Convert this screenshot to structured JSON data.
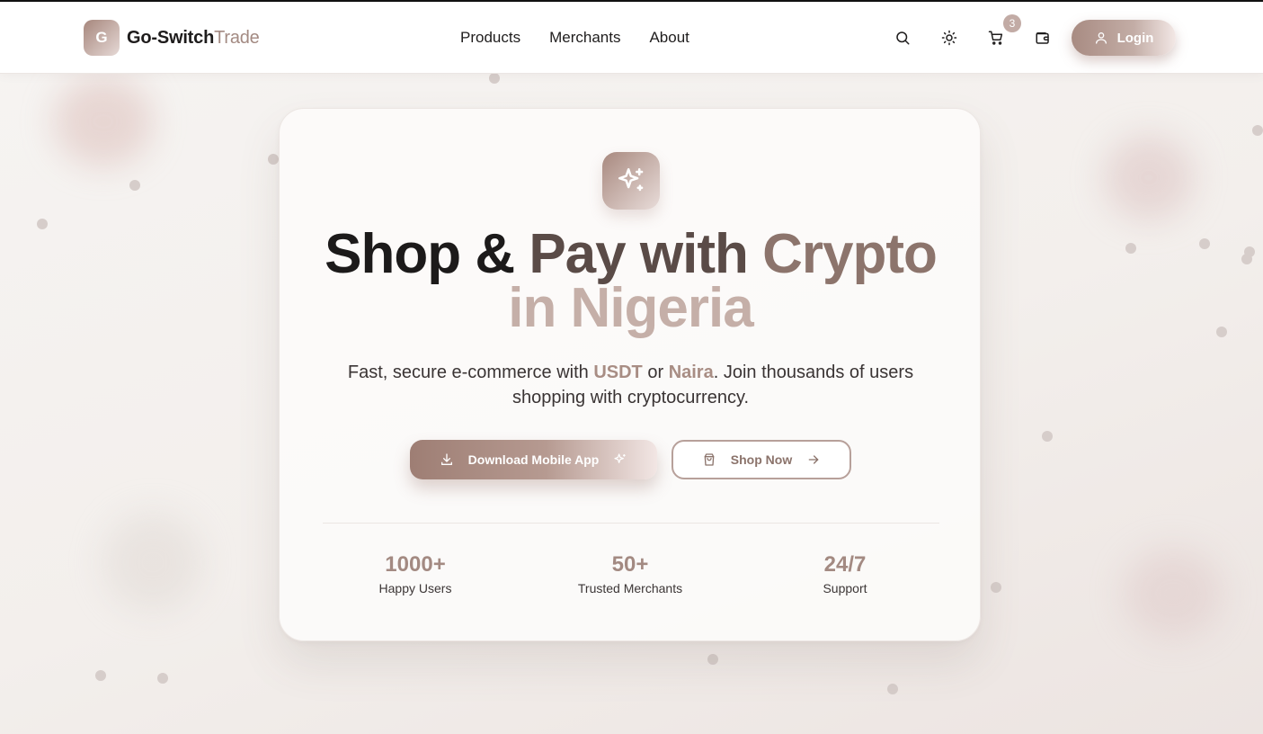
{
  "colors": {
    "accent": "#a38a82",
    "accent_dark": "#9e7e74",
    "accent_pale": "#c5afa8",
    "text_dark": "#1c1a1a"
  },
  "header": {
    "logo_letter": "G",
    "brand_bold": "Go-Switch",
    "brand_light": "Trade",
    "nav": [
      "Products",
      "Merchants",
      "About"
    ],
    "icons": [
      "search-icon",
      "sun-icon",
      "cart-icon",
      "wallet-icon"
    ],
    "cart_count": "3",
    "login_label": "Login"
  },
  "hero": {
    "icon": "sparkles-icon",
    "headline_words": [
      "Shop",
      "&",
      "Pay",
      "with",
      "Crypto"
    ],
    "headline_line2": "in Nigeria",
    "subtitle_prefix": "Fast, secure e-commerce with ",
    "subtitle_accent1": "USDT",
    "subtitle_mid": " or ",
    "subtitle_accent2": "Naira",
    "subtitle_suffix": ". Join thousands of users shopping with cryptocurrency.",
    "download_label": "Download Mobile App",
    "shop_label": "Shop Now"
  },
  "stats": [
    {
      "value": "1000+",
      "label": "Happy Users"
    },
    {
      "value": "50+",
      "label": "Trusted Merchants"
    },
    {
      "value": "24/7",
      "label": "Support"
    }
  ]
}
